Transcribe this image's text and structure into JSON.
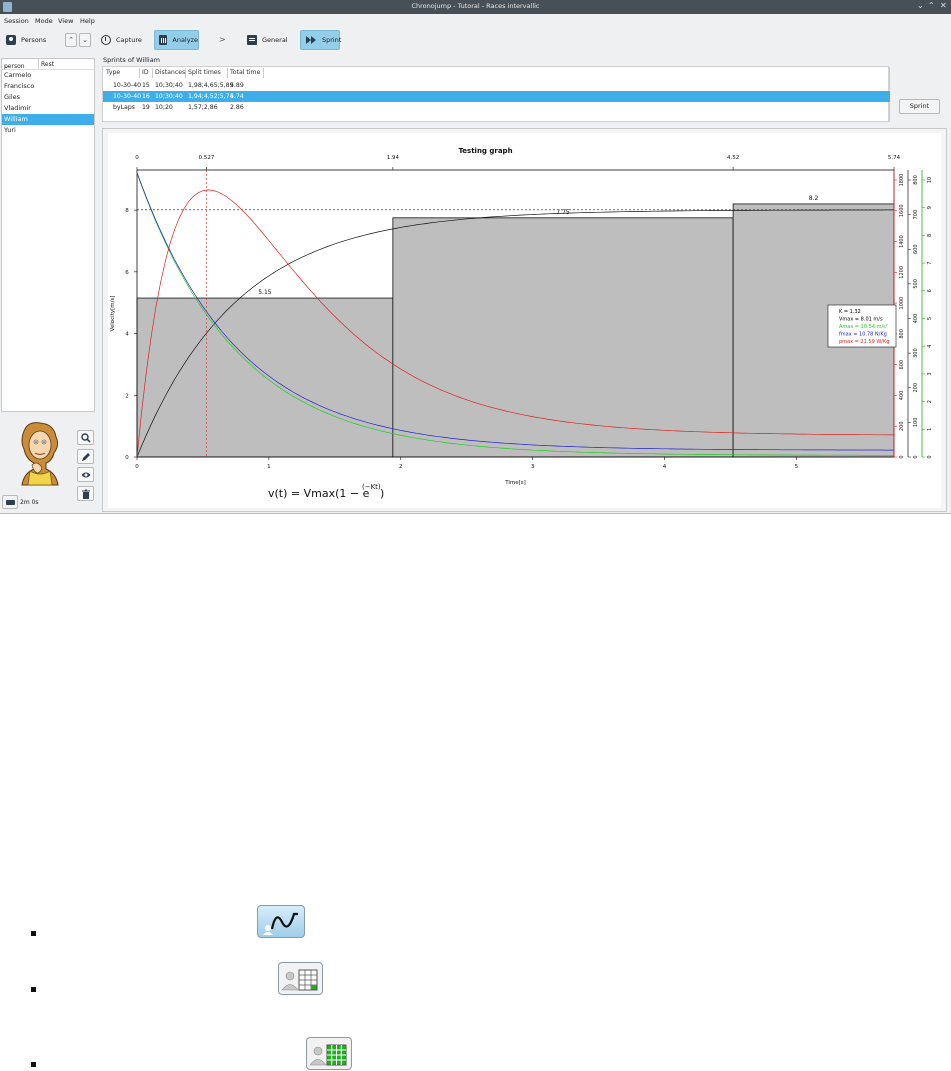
{
  "window": {
    "title": "Chronojump - Tutoral - Races intervallic"
  },
  "menu": [
    "Session",
    "Mode",
    "View",
    "Help"
  ],
  "toolbar": {
    "persons_label": "Persons",
    "capture_label": "Capture",
    "analyze_label": "Analyze",
    "chevron": ">",
    "general_label": "General",
    "sprint_label": "Sprint"
  },
  "person_list": {
    "headers": [
      "person",
      "Rest"
    ],
    "people": [
      "Carmelo",
      "Francisco",
      "Giles",
      "Vladimir",
      "William",
      "Yuri"
    ],
    "selected": "William"
  },
  "status": {
    "timer": "2m 0s"
  },
  "sprints": {
    "caption": "Sprints of William",
    "headers": [
      "Type",
      "ID",
      "Distances",
      "Split times",
      "Total time"
    ],
    "rows": [
      [
        "10-30-40",
        "15",
        "10;30;40",
        "1,98;4,65;5,89",
        "5.89"
      ],
      [
        "10-30-40",
        "16",
        "10;30;40",
        "1,94;4,52;5,74",
        "5.74"
      ],
      [
        "byLaps",
        "19",
        "10;20",
        "1,57;2,86",
        "2.86"
      ]
    ],
    "selected_index": 1,
    "button_label": "Sprint"
  },
  "chart_data": {
    "type": "line",
    "title": "Testing graph",
    "xlabel": "Time[s]",
    "ylabel": "Velocity[m/s]",
    "xlim": [
      0,
      5.74
    ],
    "ylim": [
      0,
      9.3
    ],
    "x_ticks": [
      "0",
      "1",
      "2",
      "3",
      "4",
      "5"
    ],
    "y_ticks": [
      "0",
      "2",
      "4",
      "6",
      "8"
    ],
    "top_ticks": [
      {
        "x": 0,
        "label": "0"
      },
      {
        "x": 0.527,
        "label": "0.527"
      },
      {
        "x": 1.94,
        "label": "1.94"
      },
      {
        "x": 4.52,
        "label": "4.52"
      },
      {
        "x": 5.74,
        "label": "5.74"
      }
    ],
    "bars": [
      {
        "x0": 0,
        "x1": 1.94,
        "value": 5.15,
        "label": "5.15"
      },
      {
        "x0": 1.94,
        "x1": 4.52,
        "value": 7.75,
        "label": "7.75"
      },
      {
        "x0": 4.52,
        "x1": 5.74,
        "value": 8.2,
        "label": "8.2"
      }
    ],
    "vmax": 8.01,
    "k": 1.32,
    "tpeak": 0.527,
    "right_axes": [
      {
        "color": "#d22",
        "ticks": [
          "0",
          "200",
          "400",
          "600",
          "800",
          "1000",
          "1200",
          "1400",
          "1600",
          "1800"
        ]
      },
      {
        "color": "#333",
        "ticks": [
          "0",
          "100",
          "200",
          "300",
          "400",
          "500",
          "600",
          "700",
          "800"
        ]
      },
      {
        "color": "#2a2",
        "ticks": [
          "0",
          "1",
          "2",
          "3",
          "4",
          "5",
          "6",
          "7",
          "8",
          "9",
          "10"
        ]
      }
    ],
    "legend_lines": [
      {
        "text": "K = 1.32",
        "color": "#000"
      },
      {
        "text": "Vmax = 8.01 m/s",
        "color": "#000"
      },
      {
        "text": "Amax = 10.54 m/s²",
        "color": "#22cc22"
      },
      {
        "text": "fmax = 10.78 N/Kg",
        "color": "#2222cc"
      },
      {
        "text": "pmax = 21.59 W/Kg",
        "color": "#dd2222"
      }
    ],
    "formula": "v(t) = Vmax(1 − e",
    "formula_exp": "(−Kt)",
    "formula_end": ")"
  },
  "help_icons": [
    "sprint-curve-icon",
    "person-session-icon",
    "persons-session-grid-icon"
  ]
}
